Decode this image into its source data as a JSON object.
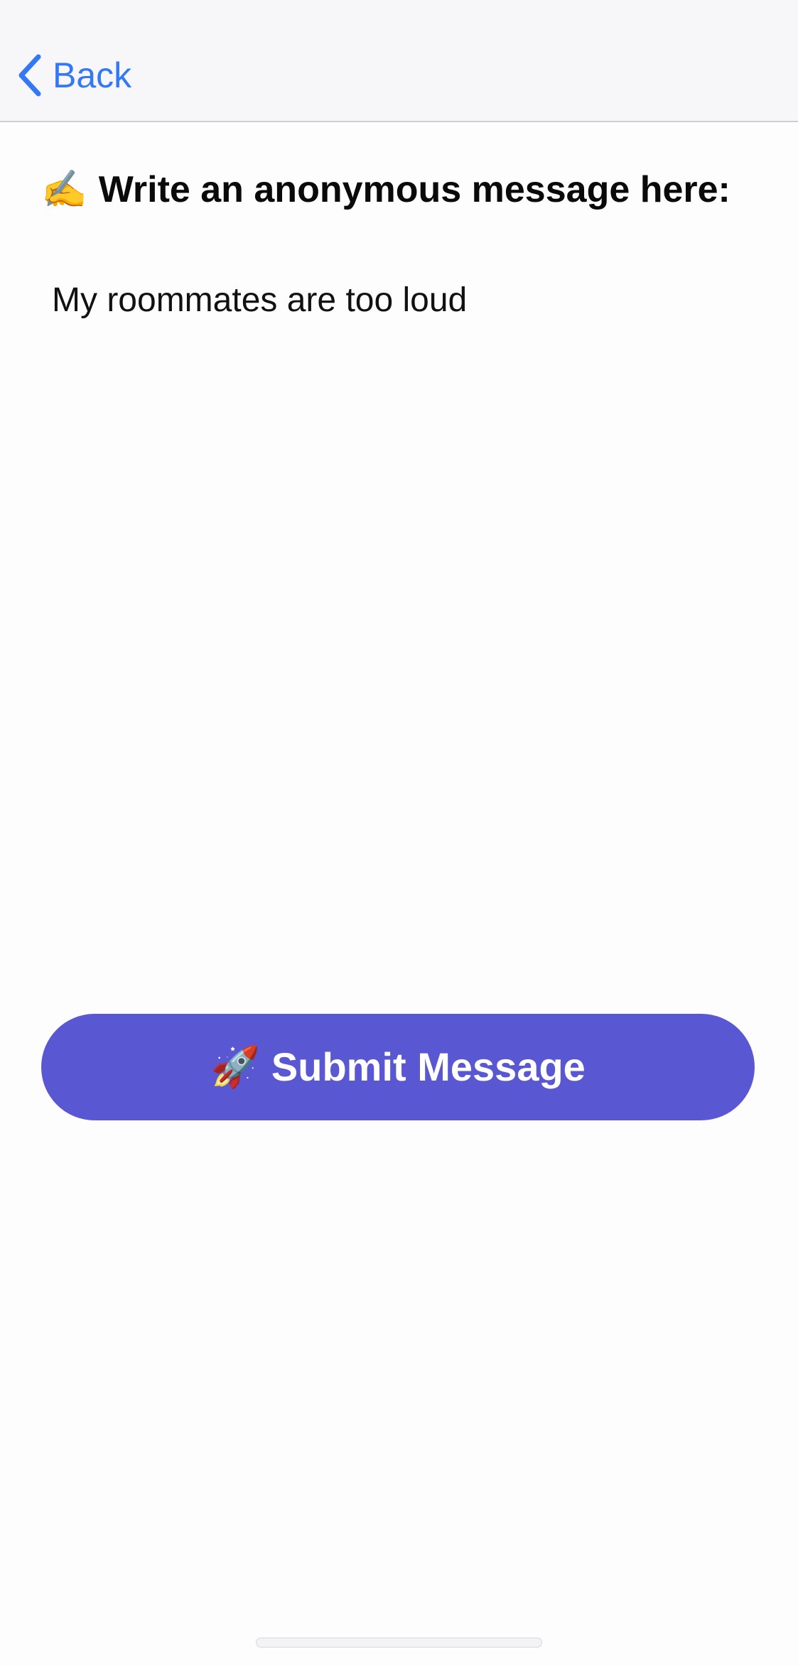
{
  "nav": {
    "back_label": "Back",
    "back_icon": "chevron-left-icon"
  },
  "composer": {
    "heading_icon": "✍️",
    "heading": "Write an anonymous message here:",
    "message_value": "My roommates are too loud"
  },
  "submit": {
    "icon": "🚀",
    "label": "Submit Message"
  },
  "colors": {
    "accent": "#3478f6",
    "button": "#5a57d2",
    "nav_background": "#f7f6f9"
  }
}
